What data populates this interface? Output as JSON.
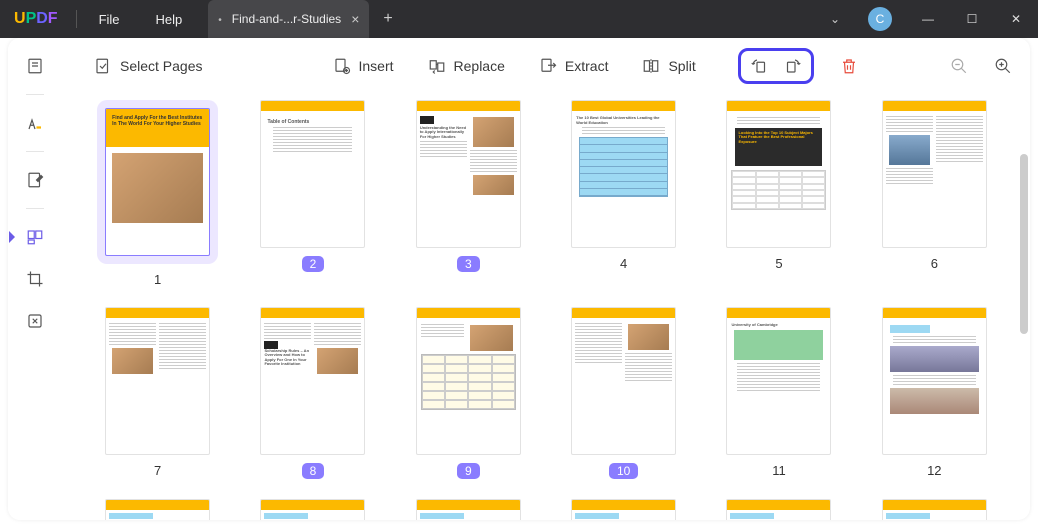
{
  "app": {
    "logo_u": "U",
    "logo_p": "P",
    "logo_d": "D",
    "logo_f": "F"
  },
  "menu": {
    "file": "File",
    "help": "Help"
  },
  "tab": {
    "title": "Find-and-...r-Studies",
    "close": "×",
    "new": "+"
  },
  "win": {
    "chevron": "⌄",
    "avatar": "C",
    "min": "—",
    "max": "☐",
    "close": "✕"
  },
  "toolbar": {
    "select": "Select Pages",
    "insert": "Insert",
    "replace": "Replace",
    "extract": "Extract",
    "split": "Split"
  },
  "pages": [
    {
      "n": "1",
      "sel": true,
      "badge": false
    },
    {
      "n": "2",
      "sel": false,
      "badge": true
    },
    {
      "n": "3",
      "sel": false,
      "badge": true
    },
    {
      "n": "4",
      "sel": false,
      "badge": false
    },
    {
      "n": "5",
      "sel": false,
      "badge": false
    },
    {
      "n": "6",
      "sel": false,
      "badge": false
    },
    {
      "n": "7",
      "sel": false,
      "badge": false
    },
    {
      "n": "8",
      "sel": false,
      "badge": true
    },
    {
      "n": "9",
      "sel": false,
      "badge": true
    },
    {
      "n": "10",
      "sel": false,
      "badge": true
    },
    {
      "n": "11",
      "sel": false,
      "badge": false
    },
    {
      "n": "12",
      "sel": false,
      "badge": false
    }
  ],
  "cover_title": "Find and Apply For the Best Institutes In The World For Your Higher Studies"
}
